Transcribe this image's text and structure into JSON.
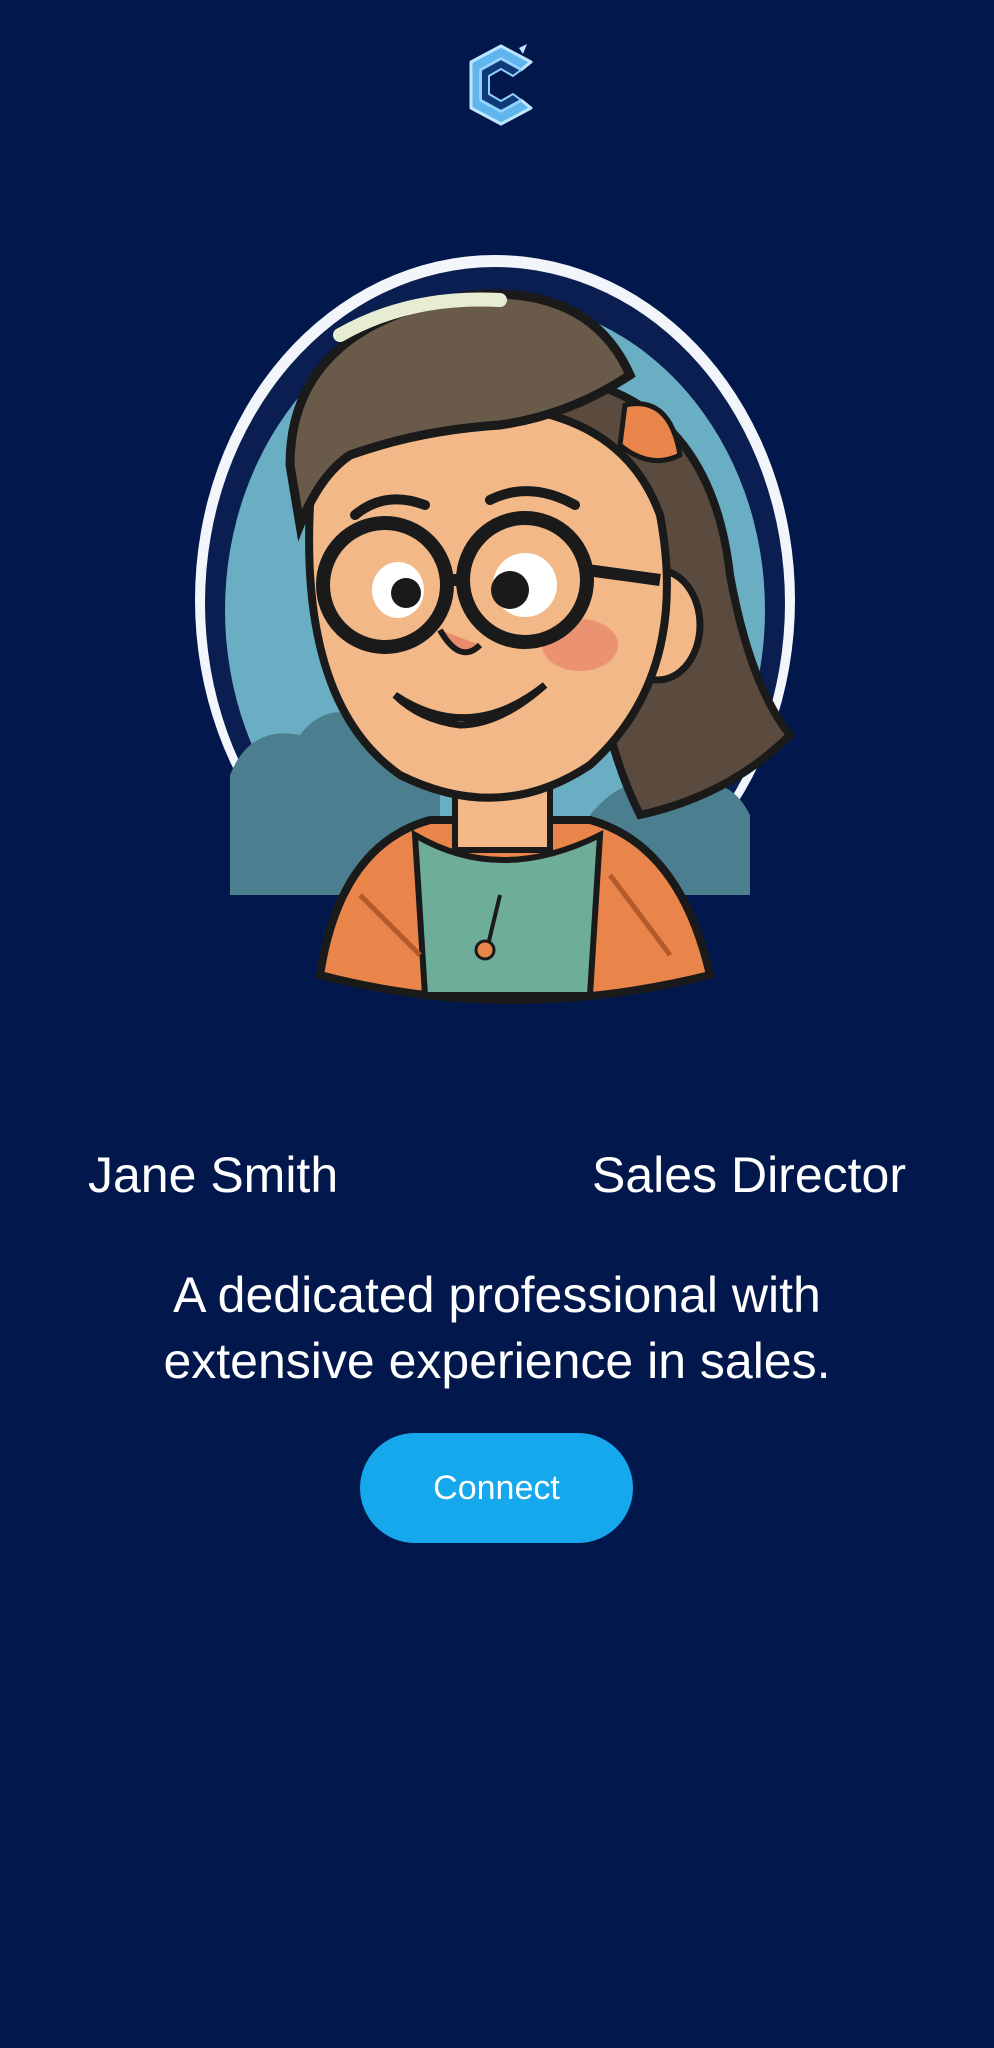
{
  "logo": {
    "icon": "c-logo-icon"
  },
  "profile": {
    "avatar_icon": "cartoon-avatar-image",
    "name": "Jane Smith",
    "role": "Sales Director",
    "bio": "A dedicated professional with extensive experience in sales."
  },
  "actions": {
    "connect_label": "Connect"
  },
  "colors": {
    "background": "#02174c",
    "accent": "#15a8ec",
    "text": "#ffffff"
  }
}
